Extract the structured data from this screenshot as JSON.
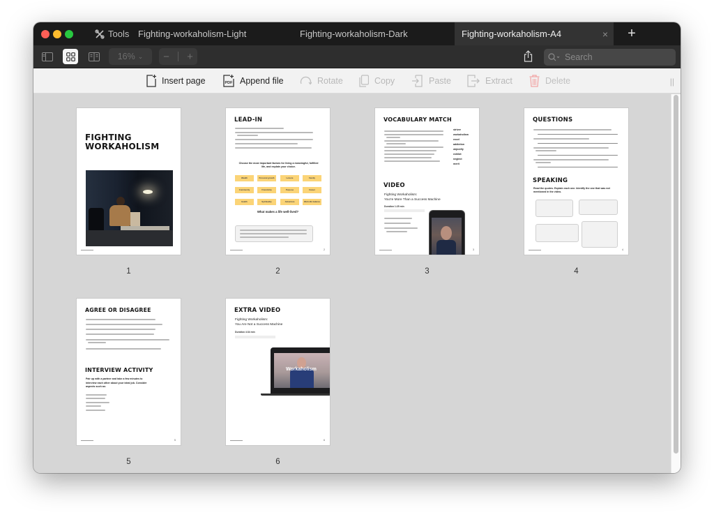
{
  "window": {
    "tools_label": "Tools",
    "tabs": [
      {
        "label": "Fighting-workaholism-Light",
        "active": false
      },
      {
        "label": "Fighting-workaholism-Dark",
        "active": false
      },
      {
        "label": "Fighting-workaholism-A4",
        "active": true
      }
    ],
    "close_glyph": "×",
    "new_tab_glyph": "+"
  },
  "toolbar": {
    "zoom_value": "16%",
    "zoom_out_glyph": "−",
    "zoom_in_glyph": "+",
    "search_placeholder": "Search"
  },
  "editbar": {
    "items": [
      {
        "label": "Insert page",
        "icon": "insert-page-icon",
        "enabled": true
      },
      {
        "label": "Append file",
        "icon": "append-pdf-icon",
        "enabled": true
      },
      {
        "label": "Rotate",
        "icon": "rotate-icon",
        "enabled": false
      },
      {
        "label": "Copy",
        "icon": "copy-icon",
        "enabled": false
      },
      {
        "label": "Paste",
        "icon": "paste-icon",
        "enabled": false
      },
      {
        "label": "Extract",
        "icon": "extract-icon",
        "enabled": false
      },
      {
        "label": "Delete",
        "icon": "trash-icon",
        "enabled": false
      }
    ],
    "grip_glyph": "||"
  },
  "pages": [
    {
      "number": "1",
      "title_line1": "FIGHTING",
      "title_line2": "WORKAHOLISM"
    },
    {
      "number": "2",
      "title": "LEAD-IN",
      "prompt": "Choose the most important factors for living a meaningful, fulfilled life, and explain your choice.",
      "factors": [
        "Wealth",
        "Personal growth",
        "Leisure",
        "Family",
        "Community",
        "Friendship",
        "Purpose",
        "Career",
        "Health",
        "Spirituality",
        "Adventure",
        "Work-life balance"
      ],
      "question": "What makes a life well-lived?"
    },
    {
      "number": "3",
      "title": "VOCABULARY MATCH",
      "words": [
        "striver",
        "workaholism",
        "excel",
        "addiction",
        "objectify",
        "exhibit",
        "neglect",
        "merit"
      ],
      "video_title": "VIDEO",
      "video_sub1": "Fighting Workaholism:",
      "video_sub2": "You're More Than a Success Machine",
      "duration": "Duration 1:25 min"
    },
    {
      "number": "4",
      "title": "QUESTIONS",
      "title2": "SPEAKING",
      "speaking_prompt": "Read the quotes. Explain each one. Identify the one that was not mentioned in the video."
    },
    {
      "number": "5",
      "title": "AGREE OR DISAGREE",
      "title2": "INTERVIEW ACTIVITY",
      "interview_prompt": "Pair up with a partner and take a few minutes to interview each other about your ideal job. Consider aspects such as:"
    },
    {
      "number": "6",
      "title": "EXTRA VIDEO",
      "video_sub1": "Fighting Workaholism:",
      "video_sub2": "You Are Not a Success Machine",
      "duration": "Duration 4:34 min",
      "screen_text": "Workaholism"
    }
  ],
  "colors": {
    "accent_tag": "#fbd477",
    "delete_red": "#f2a5a5",
    "titlebar": "#1b1b1b"
  }
}
